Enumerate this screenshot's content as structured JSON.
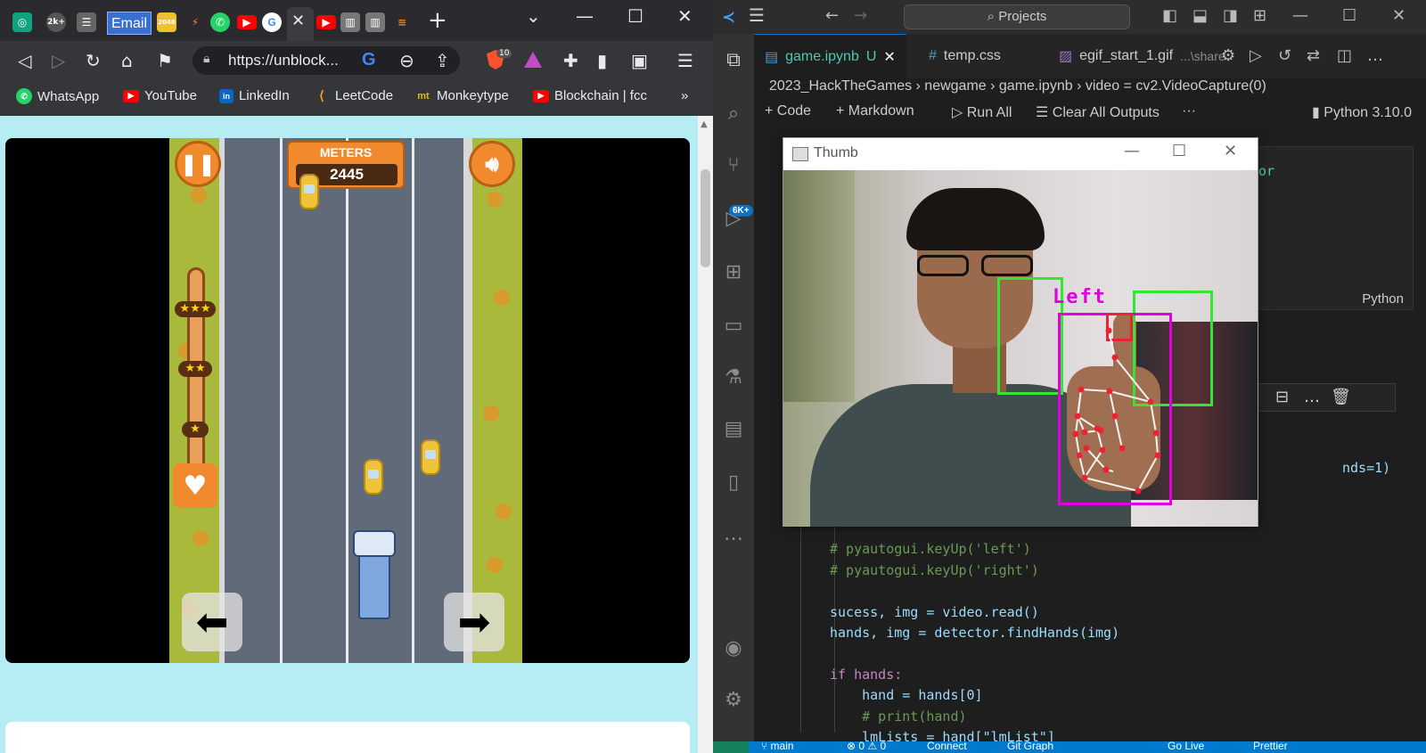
{
  "browser": {
    "tabs": [
      {
        "icon": "chatgpt-icon",
        "color": "#10a37f"
      },
      {
        "icon": "2k-icon",
        "label": "2k+",
        "color": "#555555"
      },
      {
        "icon": "list-icon",
        "color": "#666666"
      },
      {
        "icon": "email-tab",
        "label": "Email"
      },
      {
        "icon": "2048-icon",
        "label": "2048",
        "color": "#edc22e"
      },
      {
        "icon": "stack-icon",
        "color": "#f48024"
      },
      {
        "icon": "whatsapp-icon",
        "color": "#25d366"
      },
      {
        "icon": "youtube-icon",
        "color": "#ff0000"
      },
      {
        "icon": "google-icon",
        "color": "#4285f4"
      },
      {
        "icon": "youtube-icon",
        "color": "#ff0000"
      },
      {
        "icon": "reader-icon",
        "color": "#777777"
      },
      {
        "icon": "reader-icon",
        "color": "#777777"
      },
      {
        "icon": "stackoverflow-icon",
        "color": "#f48024"
      }
    ],
    "url": "https://unblock...",
    "brave_badge": "10",
    "bookmarks": [
      {
        "label": "WhatsApp",
        "icon": "whatsapp-icon",
        "color": "#25d366"
      },
      {
        "label": "YouTube",
        "icon": "youtube-icon",
        "color": "#ff0000"
      },
      {
        "label": "LinkedIn",
        "icon": "linkedin-icon",
        "color": "#0a66c2"
      },
      {
        "label": "LeetCode",
        "icon": "leetcode-icon",
        "color": "#ffa116"
      },
      {
        "label": "Monkeytype",
        "icon": "monkeytype-icon",
        "color": "#e2b714"
      },
      {
        "label": "Blockchain | fcc",
        "icon": "youtube-icon",
        "color": "#ff0000"
      }
    ],
    "more_bookmarks": "»"
  },
  "game": {
    "meters_label": "METERS",
    "meters_value": "2445",
    "progress_stars": [
      "★★★",
      "★★",
      "★"
    ]
  },
  "vscode": {
    "search_placeholder": "Projects",
    "scm_badge": "6K+",
    "tabs": [
      {
        "label": "game.ipynb",
        "suffix": "U",
        "active": true
      },
      {
        "label": "temp.css"
      },
      {
        "label": "egif_start_1.gif",
        "sub": "...\\share"
      }
    ],
    "breadcrumb": "2023_HackTheGames  ›  newgame  ›  game.ipynb  ›  video = cv2.VideoCapture(0)",
    "toolbar": {
      "code": "Code",
      "markdown": "Markdown",
      "run_all": "Run All",
      "clear_outputs": "Clear All Outputs",
      "more": "···",
      "kernel": "Python 3.10.0"
    },
    "cell_top_fragment": "tor",
    "cell_language": "Python",
    "code_fragment": "nds=1)",
    "code_lines": [
      "# pyautogui.keyUp('left')",
      "# pyautogui.keyUp('right')",
      "",
      "sucess, img = video.read()",
      "hands, img = detector.findHands(img)",
      "",
      "if hands:",
      "    hand = hands[0]",
      "    # print(hand)",
      "    lmLists = hand[\"lmList\"]"
    ],
    "status": {
      "branch": "main",
      "errors": "⊗ 0 ⚠ 0",
      "connect": "Connect",
      "git_graph": "Git Graph",
      "go_live": "Go Live",
      "prettier": "Prettier"
    }
  },
  "thumb_window": {
    "title": "Thumb",
    "overlay_label": "Left"
  }
}
